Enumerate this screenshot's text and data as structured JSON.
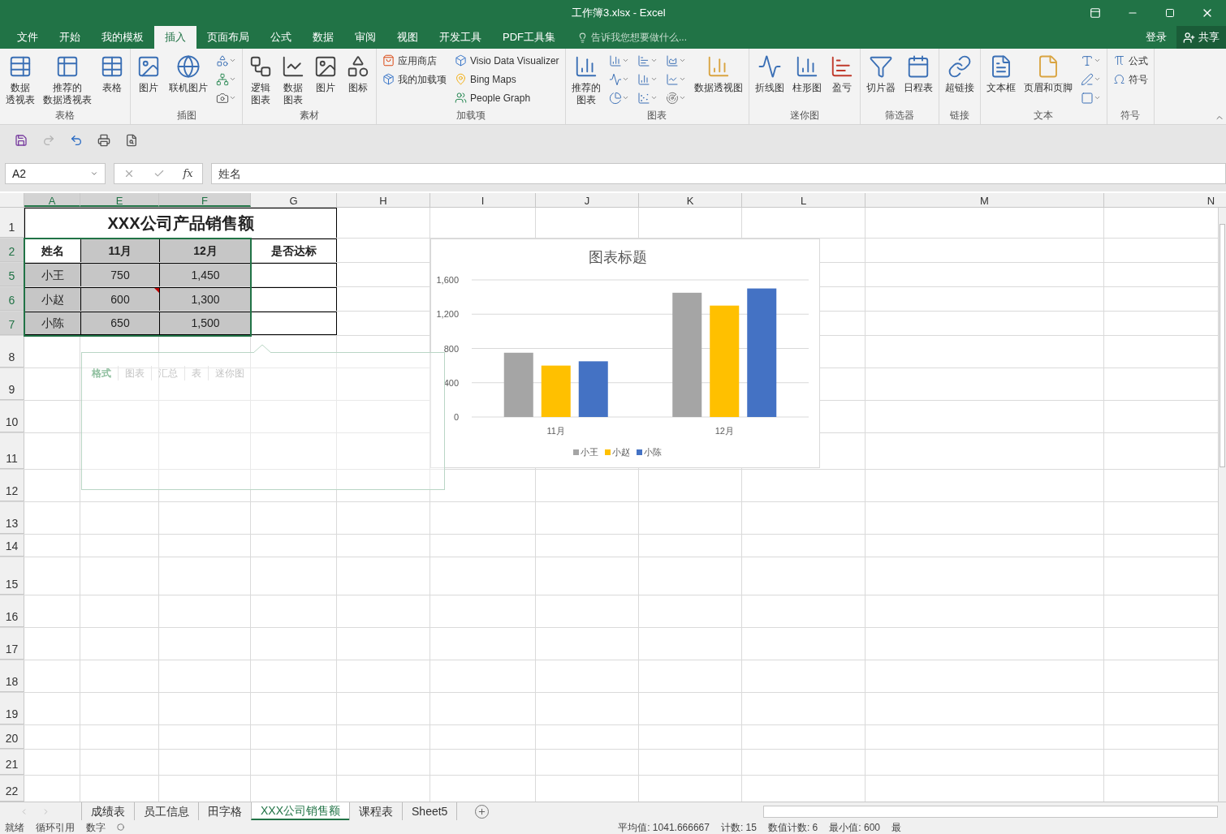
{
  "window": {
    "title": "工作簿3.xlsx - Excel"
  },
  "ribbon_tabs": [
    {
      "label": "文件",
      "selected": false
    },
    {
      "label": "开始",
      "selected": false
    },
    {
      "label": "我的模板",
      "selected": false
    },
    {
      "label": "插入",
      "selected": true
    },
    {
      "label": "页面布局",
      "selected": false
    },
    {
      "label": "公式",
      "selected": false
    },
    {
      "label": "数据",
      "selected": false
    },
    {
      "label": "审阅",
      "selected": false
    },
    {
      "label": "视图",
      "selected": false
    },
    {
      "label": "开发工具",
      "selected": false
    },
    {
      "label": "PDF工具集",
      "selected": false
    }
  ],
  "tell_me": {
    "placeholder": "告诉我您想要做什么..."
  },
  "account": {
    "sign_in": "登录",
    "share": "共享"
  },
  "ribbon_groups": [
    {
      "label": "表格",
      "columns": [
        [
          {
            "kind": "large",
            "lines": [
              "数据",
              "透视表"
            ]
          }
        ],
        [
          {
            "kind": "large",
            "lines": [
              "推荐的",
              "数据透视表"
            ]
          }
        ],
        [
          {
            "kind": "large",
            "lines": [
              "表格"
            ]
          }
        ]
      ]
    },
    {
      "label": "插图",
      "columns": [
        [
          {
            "kind": "large",
            "lines": [
              "图片"
            ]
          }
        ],
        [
          {
            "kind": "large",
            "lines": [
              "联机图片"
            ]
          }
        ],
        [
          {
            "kind": "icon"
          },
          {
            "kind": "icon"
          },
          {
            "kind": "icon"
          }
        ]
      ]
    },
    {
      "label": "素材",
      "columns": [
        [
          {
            "kind": "large",
            "lines": [
              "逻辑",
              "图表"
            ]
          }
        ],
        [
          {
            "kind": "large",
            "lines": [
              "数据",
              "图表"
            ]
          }
        ],
        [
          {
            "kind": "large",
            "lines": [
              "图片"
            ]
          }
        ],
        [
          {
            "kind": "large",
            "lines": [
              "图标"
            ]
          }
        ]
      ]
    },
    {
      "label": "加载项",
      "columns": [
        [
          {
            "kind": "small",
            "label": "应用商店"
          },
          {
            "kind": "small",
            "label": "我的加载项"
          }
        ],
        [
          {
            "kind": "small",
            "label": "Visio Data Visualizer"
          },
          {
            "kind": "small",
            "label": "Bing Maps"
          },
          {
            "kind": "small",
            "label": "People Graph"
          }
        ]
      ]
    },
    {
      "label": "图表",
      "columns": [
        [
          {
            "kind": "large",
            "lines": [
              "推荐的",
              "图表"
            ]
          }
        ],
        [
          {
            "kind": "icon"
          },
          {
            "kind": "icon"
          },
          {
            "kind": "icon"
          }
        ],
        [
          {
            "kind": "icon"
          },
          {
            "kind": "icon"
          },
          {
            "kind": "icon"
          }
        ],
        [
          {
            "kind": "icon"
          },
          {
            "kind": "icon"
          },
          {
            "kind": "icon"
          }
        ],
        [
          {
            "kind": "large",
            "lines": [
              "数据透视图"
            ]
          }
        ]
      ]
    },
    {
      "label": "迷你图",
      "columns": [
        [
          {
            "kind": "large",
            "lines": [
              "折线图"
            ]
          }
        ],
        [
          {
            "kind": "large",
            "lines": [
              "柱形图"
            ]
          }
        ],
        [
          {
            "kind": "large",
            "lines": [
              "盈亏"
            ]
          }
        ]
      ]
    },
    {
      "label": "筛选器",
      "columns": [
        [
          {
            "kind": "large",
            "lines": [
              "切片器"
            ]
          }
        ],
        [
          {
            "kind": "large",
            "lines": [
              "日程表"
            ]
          }
        ]
      ]
    },
    {
      "label": "链接",
      "columns": [
        [
          {
            "kind": "large",
            "lines": [
              "超链接"
            ]
          }
        ]
      ]
    },
    {
      "label": "文本",
      "columns": [
        [
          {
            "kind": "large",
            "lines": [
              "文本框"
            ]
          }
        ],
        [
          {
            "kind": "large",
            "lines": [
              "页眉和页脚"
            ]
          }
        ],
        [
          {
            "kind": "icon"
          },
          {
            "kind": "icon"
          },
          {
            "kind": "icon"
          }
        ]
      ]
    },
    {
      "label": "符号",
      "columns": [
        [
          {
            "kind": "small",
            "label": "公式"
          },
          {
            "kind": "small",
            "label": "符号"
          }
        ]
      ]
    }
  ],
  "formula_bar": {
    "name_box": "A2",
    "fx": "fx",
    "value": "姓名"
  },
  "columns": [
    {
      "label": "A",
      "selected": true
    },
    {
      "label": "E",
      "selected": true
    },
    {
      "label": "F",
      "selected": true
    },
    {
      "label": "G",
      "selected": false
    },
    {
      "label": "H",
      "selected": false
    },
    {
      "label": "I",
      "selected": false
    },
    {
      "label": "J",
      "selected": false
    },
    {
      "label": "K",
      "selected": false
    },
    {
      "label": "L",
      "selected": false
    },
    {
      "label": "M",
      "selected": false
    },
    {
      "label": "N",
      "selected": false
    }
  ],
  "rows": [
    {
      "label": "1",
      "selected": false
    },
    {
      "label": "2",
      "selected": true
    },
    {
      "label": "5",
      "selected": true
    },
    {
      "label": "6",
      "selected": true
    },
    {
      "label": "7",
      "selected": true
    },
    {
      "label": "8",
      "selected": false
    },
    {
      "label": "9",
      "selected": false
    },
    {
      "label": "10",
      "selected": false
    },
    {
      "label": "11",
      "selected": false
    },
    {
      "label": "12",
      "selected": false
    },
    {
      "label": "13",
      "selected": false
    },
    {
      "label": "14",
      "selected": false
    },
    {
      "label": "15",
      "selected": false
    },
    {
      "label": "16",
      "selected": false
    },
    {
      "label": "17",
      "selected": false
    },
    {
      "label": "18",
      "selected": false
    },
    {
      "label": "19",
      "selected": false
    },
    {
      "label": "20",
      "selected": false
    },
    {
      "label": "21",
      "selected": false
    },
    {
      "label": "22",
      "selected": false
    }
  ],
  "table": {
    "title": "XXX公司产品销售额",
    "header": [
      {
        "text": "姓名",
        "selected": false
      },
      {
        "text": "11月",
        "selected": true
      },
      {
        "text": "12月",
        "selected": true
      },
      {
        "text": "是否达标",
        "selected": false
      }
    ],
    "rows": [
      [
        {
          "text": "小王",
          "selected": true,
          "comment": false
        },
        {
          "text": "750",
          "selected": true,
          "comment": false
        },
        {
          "text": "1,450",
          "selected": true,
          "comment": false
        },
        {
          "selected": false,
          "comment": false
        }
      ],
      [
        {
          "text": "小赵",
          "selected": true,
          "comment": false
        },
        {
          "text": "600",
          "selected": true,
          "comment": true
        },
        {
          "text": "1,300",
          "selected": true,
          "comment": false
        },
        {
          "selected": false,
          "comment": false
        }
      ],
      [
        {
          "text": "小陈",
          "selected": true,
          "comment": false
        },
        {
          "text": "650",
          "selected": true,
          "comment": false
        },
        {
          "text": "1,500",
          "selected": true,
          "comment": false
        },
        {
          "selected": false,
          "comment": false
        }
      ]
    ]
  },
  "quick_analysis": {
    "tabs": [
      {
        "label": "格式",
        "selected": true
      },
      {
        "label": "图表",
        "selected": false
      },
      {
        "label": "汇总",
        "selected": false
      },
      {
        "label": "表",
        "selected": false
      },
      {
        "label": "迷你图",
        "selected": false
      }
    ]
  },
  "chart": {
    "chart_data": {
      "type": "bar",
      "title": "图表标题",
      "categories": [
        "11月",
        "12月"
      ],
      "series": [
        {
          "name": "小王",
          "color": "#a5a5a5",
          "values": [
            750,
            1450
          ]
        },
        {
          "name": "小赵",
          "color": "#ffc000",
          "values": [
            600,
            1300
          ]
        },
        {
          "name": "小陈",
          "color": "#4472c4",
          "values": [
            650,
            1500
          ]
        }
      ],
      "ylim": [
        0,
        1600
      ],
      "grid": true,
      "legend": true,
      "yticks": [
        {
          "value": 0,
          "label": "0"
        },
        {
          "value": 400,
          "label": "400"
        },
        {
          "value": 800,
          "label": "800"
        },
        {
          "value": 1200,
          "label": "1,200"
        },
        {
          "value": 1600,
          "label": "1,600"
        }
      ]
    }
  },
  "sheet_tabs": [
    {
      "label": "成绩表",
      "selected": false
    },
    {
      "label": "员工信息",
      "selected": false
    },
    {
      "label": "田字格",
      "selected": false
    },
    {
      "label": "XXX公司销售额",
      "selected": true
    },
    {
      "label": "课程表",
      "selected": false
    },
    {
      "label": "Sheet5",
      "selected": false
    }
  ],
  "status_bar": {
    "left": [
      "就绪",
      "循环引用",
      "数字"
    ],
    "right": [
      "平均值: 1041.666667",
      "计数: 15",
      "数值计数: 6",
      "最小值: 600",
      "最"
    ]
  }
}
